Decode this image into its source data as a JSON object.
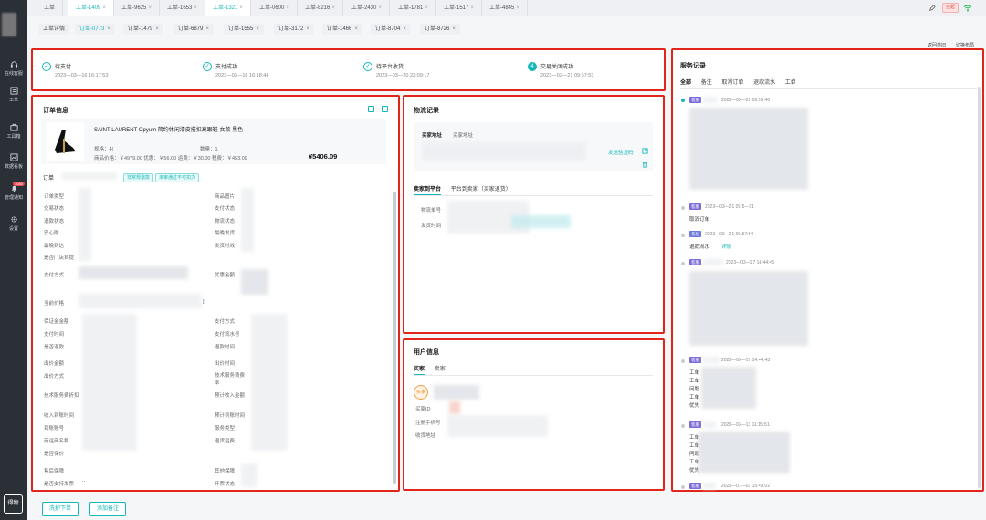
{
  "sidebar": {
    "items": [
      {
        "label": "在线客服",
        "icon": "headset-icon"
      },
      {
        "label": "工单",
        "icon": "ticket-icon"
      },
      {
        "label": "工具箱",
        "icon": "toolbox-icon"
      },
      {
        "label": "数据看板",
        "icon": "dashboard-icon"
      },
      {
        "label": "管理通知",
        "icon": "bell-icon",
        "badge": "1080"
      },
      {
        "label": "设置",
        "icon": "gear-icon"
      }
    ],
    "logo_text": "得物"
  },
  "top_tabs": [
    "工单",
    "工单-1409",
    "工单-9625",
    "工单-1653",
    "工单-1321",
    "工单-0600",
    "工单-8216",
    "工单-2430",
    "工单-1781",
    "工单-1517",
    "工单-4845"
  ],
  "top_right": {
    "status_label": "挂起"
  },
  "sub_tabs": [
    "工单详情",
    "订单-0773",
    "订单-1479",
    "订单-6879",
    "订单-1555",
    "订单-3172",
    "订单-1466",
    "订单-8704",
    "订单-8726"
  ],
  "top_links": {
    "back": "返回类旧",
    "switch_layout": "切换布局"
  },
  "steps": [
    {
      "title": "待支付",
      "time": "2023—03—16 16:17:53"
    },
    {
      "title": "支付成功",
      "time": "2023—03—16 16:18:44"
    },
    {
      "title": "待平台收货",
      "time": "2023—03—20 23:09:17"
    },
    {
      "num": "4",
      "title": "交易关闭成功",
      "time": "2023—03—21 09:57:53"
    }
  ],
  "order": {
    "title": "订单信息",
    "product_name": "SAINT LAURENT Opyum 简约休闲漆皮搭扣高跟鞋 女款 黑色",
    "spec": "规格：4(",
    "qty": "数量：1",
    "price_line": "商品价格：￥4979.00   优惠：￥56.00   运费：￥30.00   税费：￥453.09",
    "total": "¥5406.09",
    "order_no_label": "订单",
    "chips": [
      "非常规退款",
      "未审通过不可扣力"
    ],
    "left_labels": [
      "订单类型",
      "交易状态",
      "退款状态",
      "安心购",
      "最晚到达",
      "是否门店自提"
    ],
    "right_labels": [
      "商品图片",
      "支付状态",
      "物流状态",
      "最晚发货",
      "发货时效"
    ],
    "pay_method_label": "支付方式",
    "discount_label": "优惠金额",
    "current_price_label": "当前价格",
    "bracket": "]",
    "left_labels2": [
      "保证金金额",
      "支付时间",
      "是否退款",
      "出价金额",
      "出价方式",
      "技术服务费折扣",
      "收入到账时间",
      "到账账号",
      "商运商名称",
      "是否保价"
    ],
    "right_labels2": [
      "支付方式",
      "支付流水号",
      "退款时间",
      "出价时间",
      "技术服务费费率",
      "预计收入金额",
      "预计到账时间",
      "服务类型",
      "退货运费"
    ],
    "left_labels3": [
      "售后保障",
      "是否支持发票"
    ],
    "right_labels3": [
      "其他保障",
      "开票状态"
    ],
    "ellipsis": ".."
  },
  "logistics": {
    "title": "物流记录",
    "buyer_address_label": "买家地址",
    "address_value": "买家地址",
    "send_code": "发送验证码",
    "tabs": [
      "卖家到平台",
      "平台到卖家（买家退货）"
    ],
    "fields": [
      "物流单号",
      "发货时间"
    ]
  },
  "user": {
    "title": "用户信息",
    "tabs": [
      "买家",
      "卖家"
    ],
    "avatar_text": "买家",
    "fields": [
      "买家ID",
      "注册手机号",
      "收货地址"
    ]
  },
  "service": {
    "title": "服务记录",
    "tabs": [
      "全部",
      "备注",
      "取消订单",
      "退款流水",
      "工单"
    ],
    "records": [
      {
        "tag": "客服",
        "time": "2023—03—21 09:59:40"
      },
      {
        "tag": "客服",
        "time": "2023—03—21 09:5—21",
        "text": "取消订单"
      },
      {
        "tag": "系统",
        "time": "2023—03—21 09:57:54",
        "text": "退款流水",
        "link": "详情"
      },
      {
        "tag": "客服",
        "time": "2023—03—17 14:44:45"
      },
      {
        "tag": "客服",
        "time": "2023—03—17 14:44:43",
        "lines": [
          "工单",
          "工单",
          "问题",
          "工单",
          "优先"
        ]
      },
      {
        "tag": "客服",
        "time": "2023—03—13 11:15:51",
        "lines": [
          "工单",
          "工单",
          "问题",
          "工单",
          "优先"
        ]
      },
      {
        "tag": "客服",
        "time": "2023—01—03 15:49:02"
      }
    ]
  },
  "footer": {
    "btn_protect": "洗护下单",
    "btn_note": "添加备注"
  },
  "colors": {
    "accent": "#14b8b8",
    "highlight_border": "#e1251b",
    "sidebar_bg": "#2b2f36"
  }
}
